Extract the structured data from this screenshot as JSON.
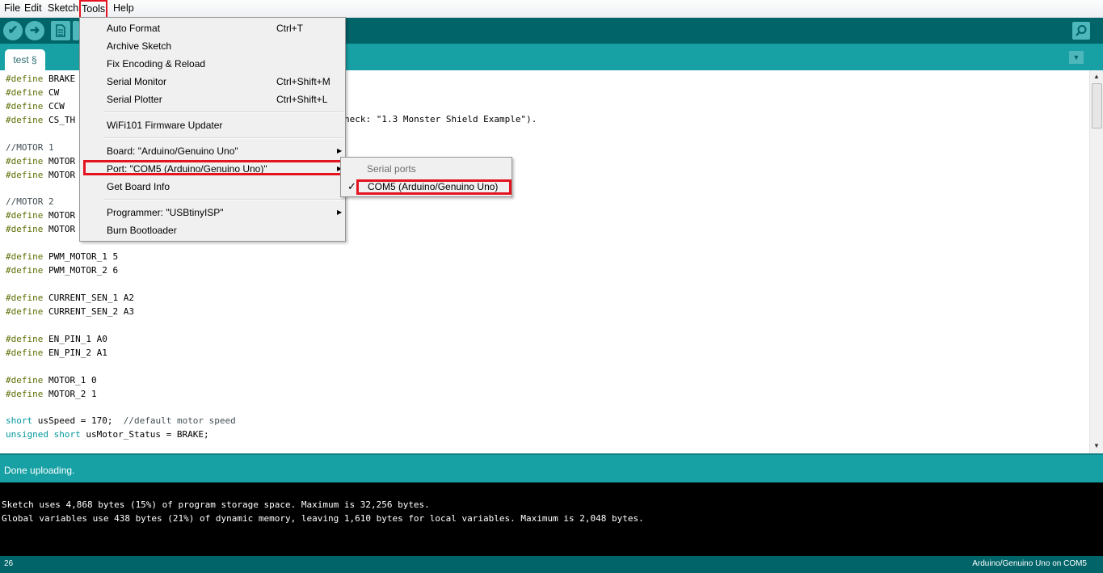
{
  "menubar": {
    "items": [
      "File",
      "Edit",
      "Sketch",
      "Tools",
      "Help"
    ],
    "active": "Tools"
  },
  "toolbar": {
    "verify_icon": "✔",
    "upload_icon": "➜",
    "new_icon": "new-file-icon",
    "serial_monitor_icon": "magnifier-icon"
  },
  "tab": {
    "label": "test §"
  },
  "tools_menu": {
    "items": [
      {
        "label": "Auto Format",
        "shortcut": "Ctrl+T"
      },
      {
        "label": "Archive Sketch",
        "shortcut": ""
      },
      {
        "label": "Fix Encoding & Reload",
        "shortcut": ""
      },
      {
        "label": "Serial Monitor",
        "shortcut": "Ctrl+Shift+M"
      },
      {
        "label": "Serial Plotter",
        "shortcut": "Ctrl+Shift+L"
      },
      {
        "label": "WiFi101 Firmware Updater",
        "shortcut": ""
      },
      {
        "label": "Board: \"Arduino/Genuino Uno\"",
        "shortcut": ""
      },
      {
        "label": "Port: \"COM5 (Arduino/Genuino Uno)\"",
        "shortcut": ""
      },
      {
        "label": "Get Board Info",
        "shortcut": ""
      },
      {
        "label": "Programmer: \"USBtinyISP\"",
        "shortcut": ""
      },
      {
        "label": "Burn Bootloader",
        "shortcut": ""
      }
    ]
  },
  "port_submenu": {
    "header": "Serial ports",
    "item": "COM5 (Arduino/Genuino Uno)",
    "checked": true
  },
  "code_lines": [
    "#define BRAKE",
    "#define CW",
    "#define CCW",
    "#define CS_TH",
    "",
    "//MOTOR 1",
    "#define MOTOR",
    "#define MOTOR",
    "",
    "//MOTOR 2",
    "#define MOTOR",
    "#define MOTOR",
    "",
    "#define PWM_MOTOR_1 5",
    "#define PWM_MOTOR_2 6",
    "",
    "#define CURRENT_SEN_1 A2",
    "#define CURRENT_SEN_2 A3",
    "",
    "#define EN_PIN_1 A0",
    "#define EN_PIN_2 A1",
    "",
    "#define MOTOR_1 0",
    "#define MOTOR_2 1",
    "",
    "short usSpeed = 170;  //default motor speed",
    "unsigned short usMotor_Status = BRAKE;"
  ],
  "code_visible_fragment": "heck: \"1.3 Monster Shield Example\").",
  "status": {
    "message": "Done uploading."
  },
  "console": {
    "lines": [
      "Sketch uses 4,868 bytes (15%) of program storage space. Maximum is 32,256 bytes.",
      "Global variables use 438 bytes (21%) of dynamic memory, leaving 1,610 bytes for local variables. Maximum is 2,048 bytes."
    ]
  },
  "footer": {
    "line_number": "26",
    "board_port": "Arduino/Genuino Uno on COM5"
  },
  "colors": {
    "teal_dark": "#006468",
    "teal": "#17a1a5",
    "highlight_red": "#e3141f"
  }
}
